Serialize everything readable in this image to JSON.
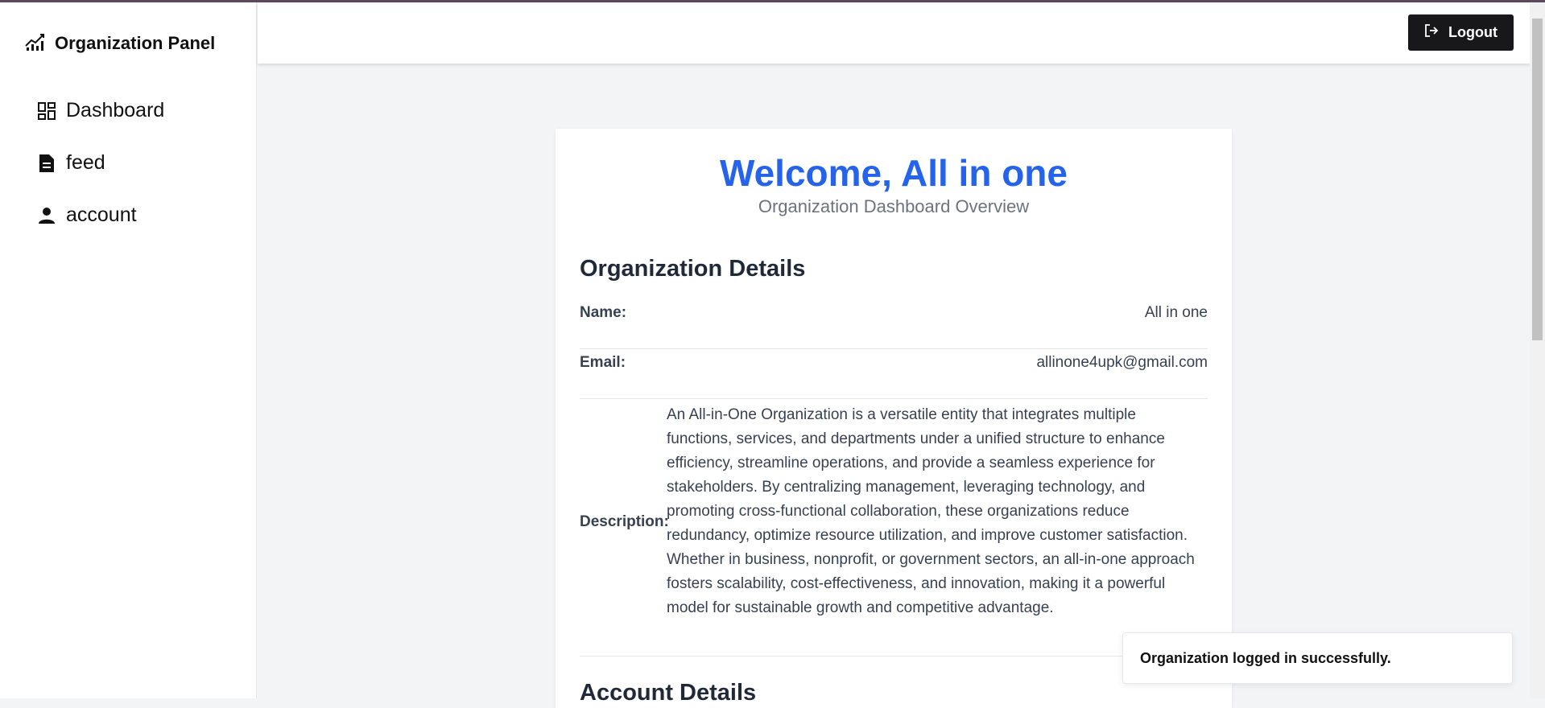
{
  "sidebar": {
    "brand": "Organization Panel",
    "items": [
      {
        "label": "Dashboard",
        "icon": "dashboard-icon"
      },
      {
        "label": "feed",
        "icon": "document-icon"
      },
      {
        "label": "account",
        "icon": "user-icon"
      }
    ]
  },
  "header": {
    "logout_label": "Logout"
  },
  "main": {
    "welcome": "Welcome, All in one",
    "subtitle": "Organization Dashboard Overview",
    "org_section_title": "Organization Details",
    "name_label": "Name:",
    "name_value": "All in one",
    "email_label": "Email:",
    "email_value": "allinone4upk@gmail.com",
    "description_label": "Description:",
    "description_value": "An All-in-One Organization is a versatile entity that integrates multiple functions, services, and departments under a unified structure to enhance efficiency, streamline operations, and provide a seamless experience for stakeholders. By centralizing management, leveraging technology, and promoting cross-functional collaboration, these organizations reduce redundancy, optimize resource utilization, and improve customer satisfaction. Whether in business, nonprofit, or government sectors, an all-in-one approach fosters scalability, cost-effectiveness, and innovation, making it a powerful model for sustainable growth and competitive advantage.",
    "account_section_title": "Account Details"
  },
  "toast": {
    "message": "Organization logged in successfully."
  },
  "colors": {
    "accent": "#2563eb",
    "button_bg": "#18181b"
  }
}
